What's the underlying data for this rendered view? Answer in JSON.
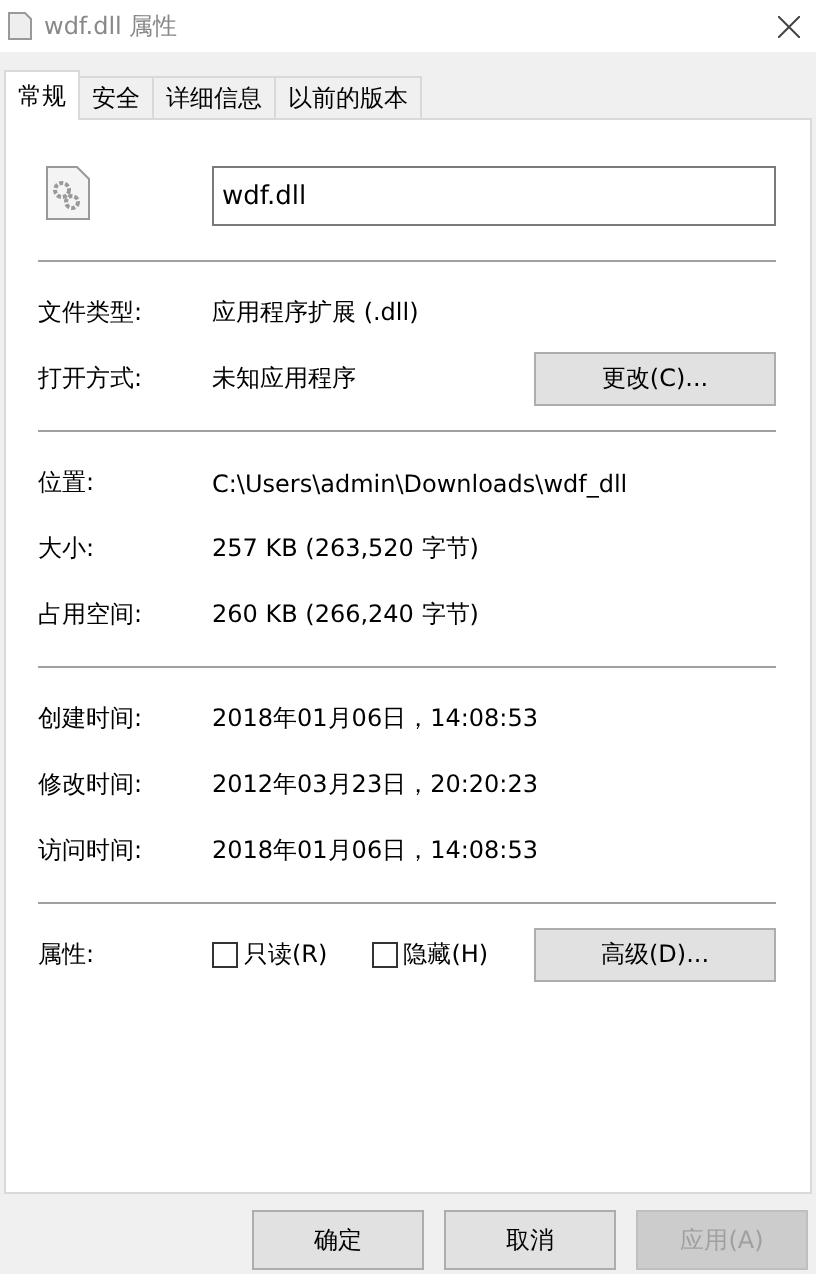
{
  "window": {
    "title": "wdf.dll 属性"
  },
  "tabs": [
    {
      "label": "常规",
      "selected": true
    },
    {
      "label": "安全",
      "selected": false
    },
    {
      "label": "详细信息",
      "selected": false
    },
    {
      "label": "以前的版本",
      "selected": false
    }
  ],
  "file_name": "wdf.dll",
  "sections": [
    [
      {
        "label": "文件类型:",
        "value": "应用程序扩展 (.dll)"
      },
      {
        "label": "打开方式:",
        "value": "未知应用程序",
        "button": "更改(C)..."
      }
    ],
    [
      {
        "label": "位置:",
        "value": "C:\\Users\\admin\\Downloads\\wdf_dll"
      },
      {
        "label": "大小:",
        "value": "257 KB (263,520 字节)"
      },
      {
        "label": "占用空间:",
        "value": "260 KB (266,240 字节)"
      }
    ],
    [
      {
        "label": "创建时间:",
        "value": "2018年01月06日，14:08:53"
      },
      {
        "label": "修改时间:",
        "value": "2012年03月23日，20:20:23"
      },
      {
        "label": "访问时间:",
        "value": "2018年01月06日，14:08:53"
      }
    ]
  ],
  "attributes": {
    "label": "属性:",
    "checkboxes": [
      {
        "label": "只读(R)",
        "checked": false
      },
      {
        "label": "隐藏(H)",
        "checked": false
      }
    ],
    "button": "高级(D)..."
  },
  "buttons": [
    {
      "label": "确定",
      "disabled": false
    },
    {
      "label": "取消",
      "disabled": false
    },
    {
      "label": "应用(A)",
      "disabled": true
    }
  ]
}
